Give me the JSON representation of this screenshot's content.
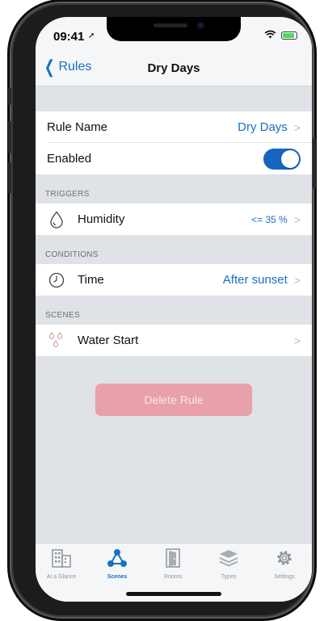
{
  "status_bar": {
    "time": "09:41",
    "location_arrow": "➚"
  },
  "nav": {
    "back_label": "Rules",
    "title": "Dry Days"
  },
  "general": {
    "rule_name_label": "Rule Name",
    "rule_name_value": "Dry Days",
    "enabled_label": "Enabled",
    "enabled": true
  },
  "triggers": {
    "header": "TRIGGERS",
    "items": [
      {
        "icon": "droplet-icon",
        "label": "Humidity",
        "value": "<= 35 %"
      }
    ]
  },
  "conditions": {
    "header": "CONDITIONS",
    "items": [
      {
        "icon": "clock-icon",
        "label": "Time",
        "value": "After sunset"
      }
    ]
  },
  "scenes": {
    "header": "SCENES",
    "items": [
      {
        "icon": "water-drops-icon",
        "label": "Water Start"
      }
    ]
  },
  "delete_button": {
    "label": "Delete Rule"
  },
  "tab_bar": {
    "tabs": [
      {
        "icon": "building-icon",
        "label": "At a Glance",
        "active": false
      },
      {
        "icon": "network-icon",
        "label": "Scenes",
        "active": true
      },
      {
        "icon": "door-icon",
        "label": "Rooms",
        "active": false
      },
      {
        "icon": "layers-icon",
        "label": "Types",
        "active": false
      },
      {
        "icon": "gear-icon",
        "label": "Settings",
        "active": false
      }
    ]
  },
  "colors": {
    "accent": "#1b6fc4",
    "toggle_on": "#1565c0",
    "delete_button": "#e8a0ab",
    "background": "#dfe2e6"
  }
}
